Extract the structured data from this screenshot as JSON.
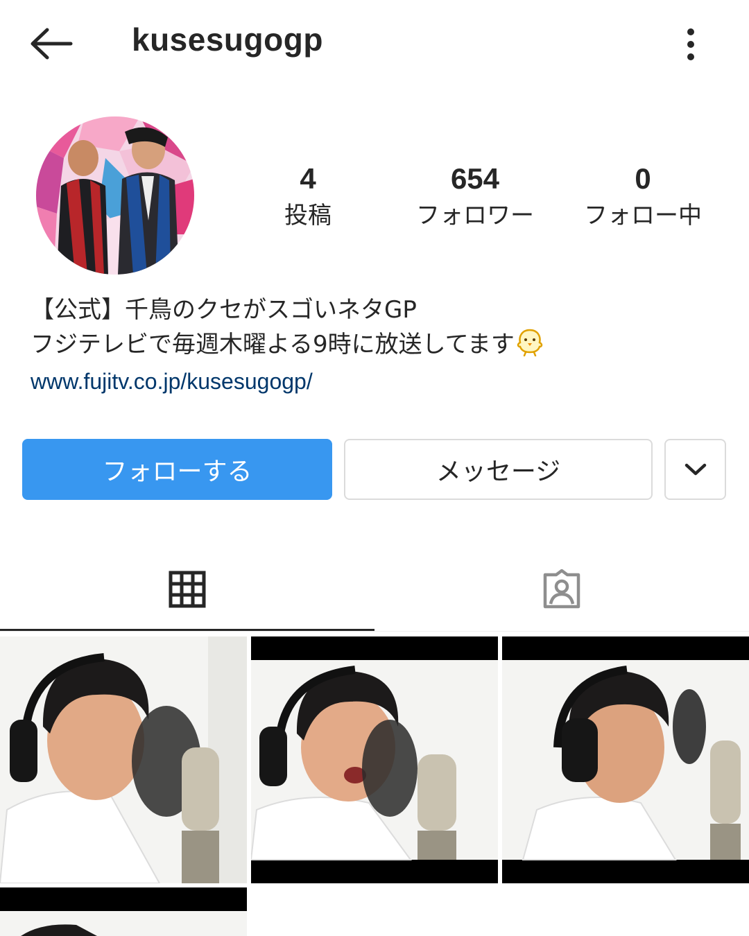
{
  "header": {
    "username": "kusesugogp",
    "back_icon": "arrow-left-icon",
    "more_icon": "more-vertical-icon"
  },
  "profile": {
    "stats": [
      {
        "value": "4",
        "label": "投稿"
      },
      {
        "value": "654",
        "label": "フォロワー"
      },
      {
        "value": "0",
        "label": "フォロー中"
      }
    ],
    "bio": {
      "line1": "【公式】千鳥のクセがスゴいネタGP",
      "line2": "フジテレビで毎週木曜よる9時に放送してます",
      "emoji_icon": "baby-chick-icon",
      "link": "www.fujitv.co.jp/kusesugogp/"
    }
  },
  "actions": {
    "follow_label": "フォローする",
    "message_label": "メッセージ",
    "dropdown_icon": "chevron-down-icon"
  },
  "tabs": [
    {
      "icon": "grid-icon",
      "active": true
    },
    {
      "icon": "tagged-person-icon",
      "active": false
    }
  ],
  "colors": {
    "follow_button": "#3897f0",
    "link": "#00376b",
    "text": "#262626",
    "border": "#dbdbdb"
  }
}
